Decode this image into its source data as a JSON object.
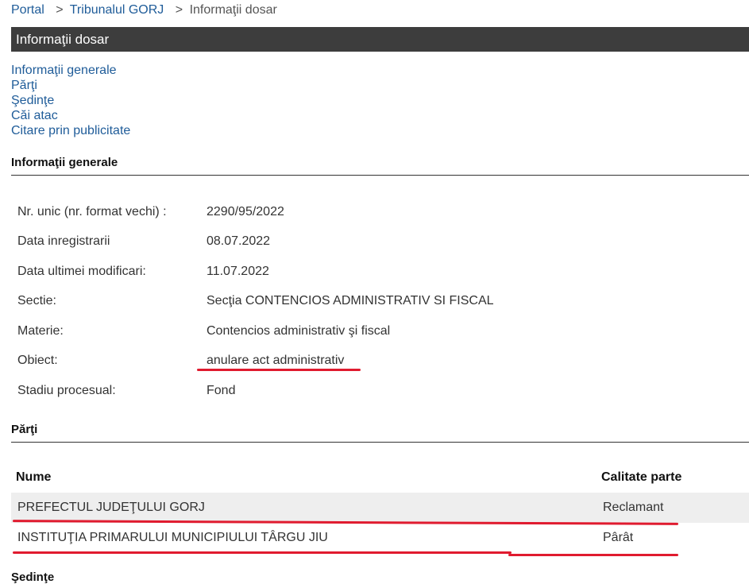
{
  "breadcrumb": {
    "portal": "Portal",
    "court": "Tribunalul GORJ",
    "current": "Informaţii dosar",
    "separator": ">"
  },
  "title": "Informaţii dosar",
  "toc": [
    "Informaţii generale",
    "Părţi",
    "Şedinţe",
    "Căi atac",
    "Citare prin publicitate"
  ],
  "sections": {
    "general": "Informaţii generale",
    "parts": "Părţi",
    "hearings": "Şedinţe"
  },
  "general_info": [
    {
      "label": "Nr. unic (nr. format vechi) :",
      "value": "2290/95/2022"
    },
    {
      "label": "Data inregistrarii",
      "value": "08.07.2022"
    },
    {
      "label": "Data ultimei modificari:",
      "value": "11.07.2022"
    },
    {
      "label": "Sectie:",
      "value": "Secţia CONTENCIOS ADMINISTRATIV SI FISCAL"
    },
    {
      "label": "Materie:",
      "value": "Contencios administrativ şi fiscal"
    },
    {
      "label": "Obiect:",
      "value": "anulare act administrativ"
    },
    {
      "label": "Stadiu procesual:",
      "value": "Fond"
    }
  ],
  "parts": {
    "headers": {
      "name": "Nume",
      "role": "Calitate parte"
    },
    "rows": [
      {
        "name": "PREFECTUL JUDEŢULUI GORJ",
        "role": "Reclamant"
      },
      {
        "name": "INSTITUŢIA PRIMARULUI MUNICIPIULUI TÂRGU JIU",
        "role": "Pârât"
      }
    ]
  },
  "colors": {
    "title_bar": "#3d3d3d",
    "link": "#1f5c99",
    "row_shade": "#eeeeee",
    "annotation_marker": "#e01b2f"
  }
}
